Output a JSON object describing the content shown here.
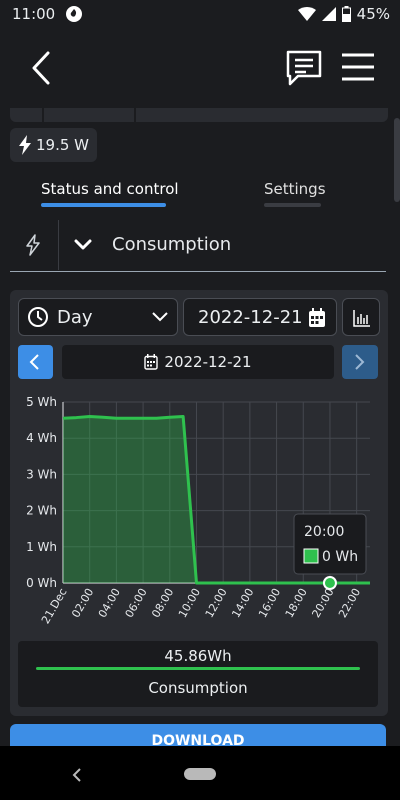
{
  "status_bar": {
    "time": "11:00",
    "battery": "45%"
  },
  "device": {
    "power_reading": "19.5 W"
  },
  "tabs": [
    {
      "label": "Status and control",
      "active": true
    },
    {
      "label": "Settings",
      "active": false
    }
  ],
  "section": {
    "title": "Consumption"
  },
  "controls": {
    "period": "Day",
    "date_input": "2022-12-21",
    "current_date": "2022-12-21"
  },
  "chart_data": {
    "type": "area",
    "series": [
      {
        "name": "Consumption",
        "color": "#2fc14e",
        "x": [
          "00:00",
          "01:00",
          "02:00",
          "03:00",
          "04:00",
          "05:00",
          "06:00",
          "07:00",
          "08:00",
          "09:00",
          "10:00",
          "11:00",
          "12:00",
          "13:00",
          "14:00",
          "15:00",
          "16:00",
          "17:00",
          "18:00",
          "19:00",
          "20:00",
          "21:00",
          "22:00",
          "23:00"
        ],
        "values": [
          4.55,
          4.57,
          4.6,
          4.58,
          4.55,
          4.55,
          4.55,
          4.55,
          4.58,
          4.6,
          0,
          0,
          0,
          0,
          0,
          0,
          0,
          0,
          0,
          0,
          0,
          0,
          0,
          0
        ]
      }
    ],
    "x_tick_labels": [
      "21.Dec",
      "02:00",
      "04:00",
      "06:00",
      "08:00",
      "10:00",
      "12:00",
      "14:00",
      "16:00",
      "18:00",
      "20:00",
      "22:00"
    ],
    "y_tick_labels": [
      "0 Wh",
      "1 Wh",
      "2 Wh",
      "3 Wh",
      "4 Wh",
      "5 Wh"
    ],
    "ylim": [
      0,
      5
    ],
    "grid": true,
    "tooltip": {
      "time": "20:00",
      "value": "0 Wh"
    }
  },
  "summary": {
    "total": "45.86Wh",
    "label": "Consumption"
  },
  "actions": {
    "download": "DOWNLOAD"
  }
}
